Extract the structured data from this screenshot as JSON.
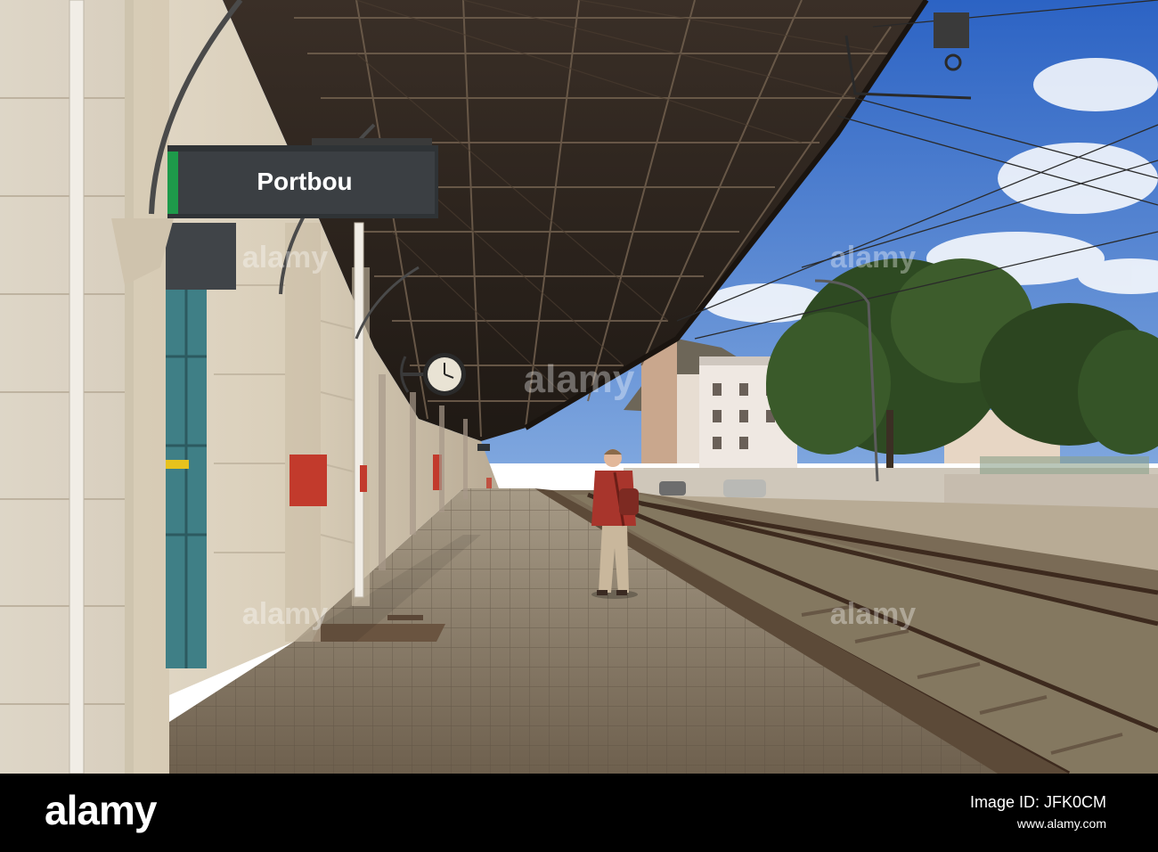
{
  "photo": {
    "station_sign": "Portbou",
    "watermark": "alamy"
  },
  "footer": {
    "brand": "alamy",
    "image_id_label": "Image ID:",
    "image_id": "JFK0CM",
    "site": "www.alamy.com"
  },
  "colors": {
    "sky": "#3f74c9",
    "canopy": "#2f2620",
    "stone_wall": "#e6dccc",
    "platform": "#8a7a64",
    "sign_bg": "#2f3336",
    "sign_accent": "#1e9a4a",
    "footer_bg": "#000000"
  }
}
